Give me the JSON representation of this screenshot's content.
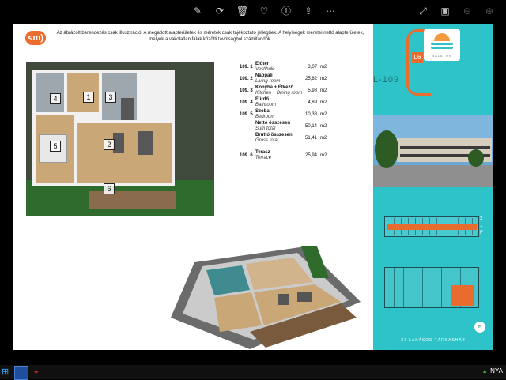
{
  "toolbar": {
    "left_icons": [
      "draw-icon",
      "rotate-icon",
      "delete-icon",
      "heart-icon",
      "info-icon",
      "share-icon",
      "more-icon"
    ],
    "left_glyphs": [
      "✎",
      "⟳",
      "🗑",
      "♡",
      "ⓘ",
      "⇪",
      "⋯"
    ],
    "right_icons": [
      "fullscreen-icon",
      "fit-icon",
      "zoom-out-icon",
      "zoom-in-icon"
    ],
    "right_glyphs": [
      "⤢",
      "▣",
      "⊖",
      "⊕"
    ]
  },
  "document": {
    "logo_text": "<m)",
    "disclaimer": "Az ábrázolt berendezés csak illusztráció. A megadott alapterületek és méretek csak tájékoztató jellegűek. A helyiségek méretei nettó alapterületek, melyek a vakolatlan falak közötti távolságból számítandók.",
    "plan_numbers": [
      "1",
      "2",
      "3",
      "4",
      "5",
      "6"
    ],
    "rooms": [
      {
        "num": "109. 1",
        "name": "Előtér",
        "en": "Vestibule",
        "area": "3,07",
        "unit": "m2"
      },
      {
        "num": "109. 2",
        "name": "Nappali",
        "en": "Living-room",
        "area": "25,82",
        "unit": "m2"
      },
      {
        "num": "109. 3",
        "name": "Konyha + Étkező",
        "en": "Kitchen + Dining room",
        "area": "5,98",
        "unit": "m2"
      },
      {
        "num": "109. 4",
        "name": "Fürdő",
        "en": "Bathroom",
        "area": "4,89",
        "unit": "m2"
      },
      {
        "num": "109. 5",
        "name": "Szoba",
        "en": "Bedroom",
        "area": "10,38",
        "unit": "m2"
      }
    ],
    "totals": [
      {
        "name": "Nettó összesen",
        "en": "Sum total",
        "area": "50,14",
        "unit": "m2"
      },
      {
        "name": "Bruttó összesen",
        "en": "Gross total",
        "area": "51,41",
        "unit": "m2"
      }
    ],
    "terrace": {
      "num": "109. 6",
      "name": "Terasz",
      "en": "Terrace",
      "area": "25,94",
      "unit": "m2"
    }
  },
  "sidepanel": {
    "brand_text": "BALATON",
    "block": "L6",
    "unit": "L-109",
    "floor_marks": [
      "2",
      "1",
      "F"
    ],
    "footer": "27 LAKÁSOS TÁRSASHÁZ",
    "badge": "m"
  },
  "taskbar": {
    "start_glyph": "⊞",
    "app2_glyph": "✦",
    "lang": "NYA"
  },
  "colors": {
    "accent": "#e96b2e",
    "panel": "#2ec3c9"
  }
}
